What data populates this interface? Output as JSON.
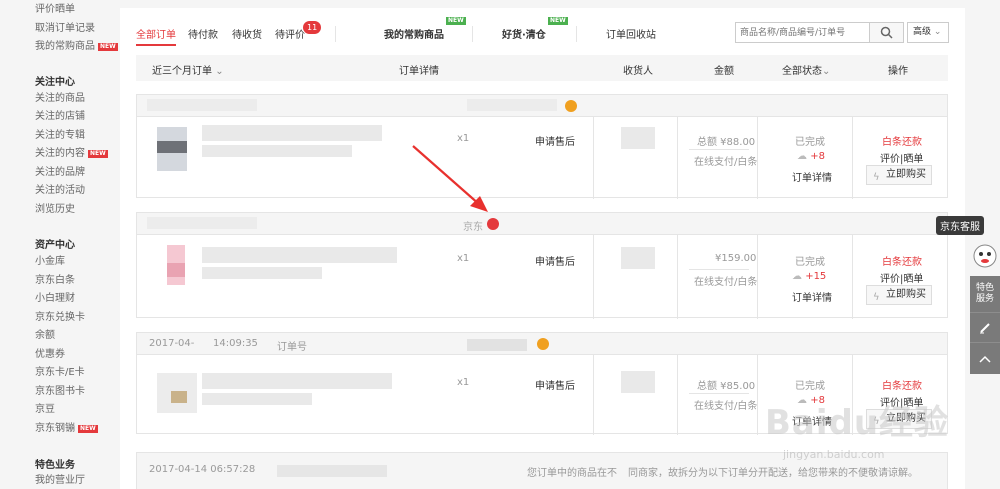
{
  "sidebar": {
    "top_items": [
      "评价晒单",
      "取消订单记录",
      "我的常购商品"
    ],
    "top_item_badges": [
      "",
      "",
      "NEW"
    ],
    "follow": {
      "title": "关注中心",
      "items": [
        "关注的商品",
        "关注的店铺",
        "关注的专辑",
        "关注的内容",
        "关注的品牌",
        "关注的活动",
        "浏览历史"
      ],
      "badges": [
        "",
        "",
        "",
        "NEW",
        "",
        "",
        ""
      ]
    },
    "assets": {
      "title": "资产中心",
      "items": [
        "小金库",
        "京东白条",
        "小白理财",
        "京东兑换卡",
        "余额",
        "优惠券",
        "京东卡/E卡",
        "京东图书卡",
        "京豆",
        "京东钢镚"
      ],
      "badges": [
        "",
        "",
        "",
        "",
        "",
        "",
        "",
        "",
        "",
        "NEW"
      ]
    },
    "special": {
      "title": "特色业务",
      "items": [
        "我的营业厅"
      ]
    }
  },
  "tabs": {
    "all": "全部订单",
    "pay": "待付款",
    "receive": "待收货",
    "review": "待评价",
    "review_count": "11",
    "frequent": "我的常购商品",
    "clearance": "好货·清仓",
    "recycle": "订单回收站",
    "new_badge": "NEW"
  },
  "search": {
    "placeholder": "商品名称/商品编号/订单号",
    "advanced": "高级"
  },
  "table_header": {
    "period": "近三个月订单",
    "details": "订单详情",
    "receiver": "收货人",
    "amount": "金额",
    "status": "全部状态",
    "action": "操作"
  },
  "orders": [
    {
      "date": "",
      "order_no_label": "",
      "shop": "",
      "qty": "x1",
      "after_sale": "申请售后",
      "amount": "总额 ¥88.00",
      "payment": "在线支付/白条",
      "status": "已完成",
      "beans": "+8",
      "detail": "订单详情",
      "action_red": "白条还款",
      "action_links": "评价|晒单",
      "buy_again": "立即购买"
    },
    {
      "date": "",
      "order_no_label": "",
      "shop": "京东",
      "qty": "x1",
      "after_sale": "申请售后",
      "amount": "¥159.00",
      "payment": "在线支付/白条",
      "status": "已完成",
      "beans": "+15",
      "detail": "订单详情",
      "action_red": "白条还款",
      "action_links": "评价|晒单",
      "buy_again": "立即购买"
    },
    {
      "date": "2017-04-",
      "time": "14:09:35",
      "order_no_label": "订单号",
      "shop": "",
      "qty": "x1",
      "after_sale": "申请售后",
      "amount": "总额 ¥85.00",
      "payment": "在线支付/白条",
      "status": "已完成",
      "beans": "+8",
      "detail": "订单详情",
      "action_red": "白条还款",
      "action_links": "评价|晒单",
      "buy_again": "立即购买"
    },
    {
      "date": "2017-04-14 06:57:28",
      "notice": "您订单中的商品在不",
      "notice_tail": "同商家，故拆分为以下订单分开配送，给您带来的不便敬请谅解。"
    }
  ],
  "float_bar": {
    "service": "京东客服",
    "special": "特色服务"
  },
  "watermark": {
    "brand": "Baidu经验",
    "url": "jingyan.baidu.com"
  },
  "colors": {
    "accent": "#e4393c",
    "new_green": "#4bb04f",
    "sidebar_bg": "#f5f5f5"
  }
}
